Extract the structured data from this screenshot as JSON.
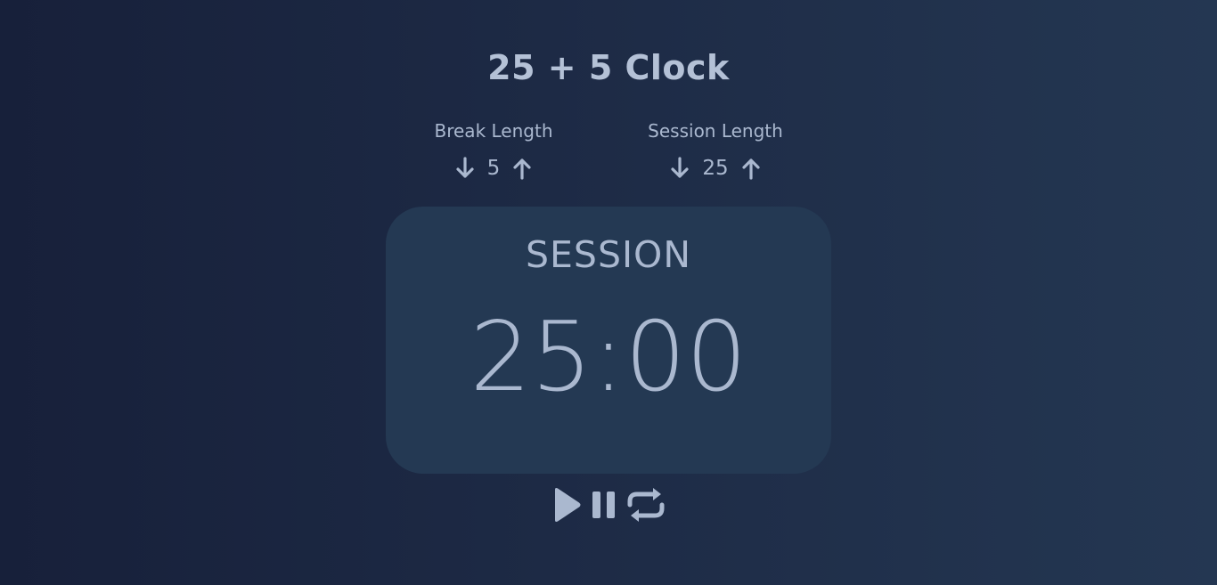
{
  "app": {
    "title": "25 + 5 Clock"
  },
  "break": {
    "label": "Break Length",
    "value": "5",
    "decrement_icon": "arrow-down-icon",
    "increment_icon": "arrow-up-icon"
  },
  "session": {
    "label": "Session Length",
    "value": "25",
    "decrement_icon": "arrow-down-icon",
    "increment_icon": "arrow-up-icon"
  },
  "timer": {
    "label": "SESSION",
    "time_left": "25:00"
  },
  "controls": {
    "play_icon": "play-icon",
    "pause_icon": "pause-icon",
    "reset_icon": "repeat-icon"
  },
  "colors": {
    "background_start": "#17203a",
    "background_end": "#243752",
    "card": "#243953",
    "text": "#aab8cf"
  }
}
